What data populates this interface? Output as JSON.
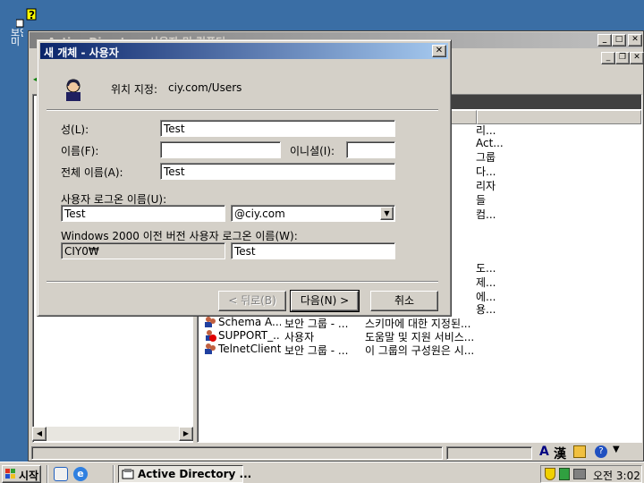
{
  "desktop": {
    "icon_label": "보안\n미"
  },
  "app_window": {
    "title": "Active Directory 사용자 및 컴퓨터"
  },
  "list_rows": [
    {
      "name": "Schema A...",
      "type": "보안 그룹 - ...",
      "desc": "스키마에 대한 지정된..."
    },
    {
      "name": "SUPPORT_...",
      "type": "사용자",
      "desc": "도움말 및 지원 서비스..."
    },
    {
      "name": "TelnetClients",
      "type": "보안 그룹 - ...",
      "desc": "이 그룹의 구성원은 시..."
    }
  ],
  "list_fragments": [
    "리...",
    "Act...",
    "그룹",
    "다...",
    "리자",
    "들",
    "컴...",
    "도...",
    "제...",
    "에...",
    "용..."
  ],
  "dialog": {
    "title": "새 개체 - 사용자",
    "location_label": "위치 지정:",
    "location_value": "ciy.com/Users",
    "last_name_label": "성(L):",
    "last_name_value": "Test",
    "first_name_label": "이름(F):",
    "first_name_value": "",
    "initials_label": "이니셜(I):",
    "initials_value": "",
    "full_name_label": "전체 이름(A):",
    "full_name_value": "Test",
    "logon_label": "사용자 로그온 이름(U):",
    "logon_value": "Test",
    "domain_value": "@ciy.com",
    "pre2000_label": "Windows 2000 이전 버전 사용자 로그온 이름(W):",
    "pre2000_domain": "CIY0₩",
    "pre2000_value": "Test",
    "back_label": "< 뒤로(B)",
    "next_label": "다음(N) >",
    "cancel_label": "취소"
  },
  "taskbar": {
    "start_label": "시작",
    "task_label": "Active Directory ...",
    "clock": "오전 3:02"
  },
  "statusbar": {
    "ime_a": "A",
    "ime_han": "漢"
  }
}
